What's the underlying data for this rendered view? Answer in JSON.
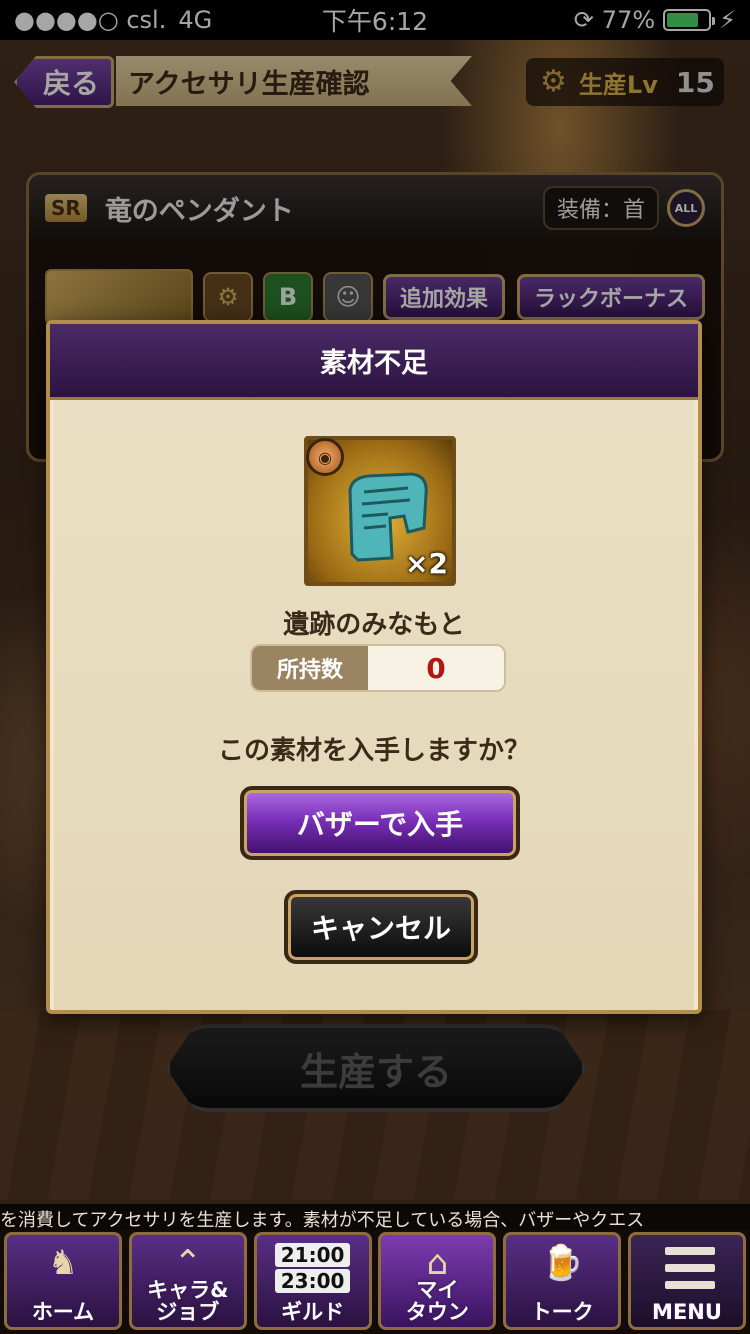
{
  "statusbar": {
    "carrier": "●●●●○ csl.",
    "network": "4G",
    "time": "下午6:12",
    "battery": "77%"
  },
  "header": {
    "back": "戻る",
    "title": "アクセサリ生産確認",
    "level_label": "生産Lv",
    "level_value": "15"
  },
  "item": {
    "rarity": "SR",
    "name": "竜のペンダント",
    "equip": "装備：首",
    "all_label": "ALL",
    "effect_button": "追加効果",
    "luck_button": "ラックボーナス"
  },
  "produce_button": "生産する",
  "modal": {
    "title": "素材不足",
    "material_name": "遺跡のみなもと",
    "quantity": "×2",
    "owned_label": "所持数",
    "owned_value": "0",
    "question": "この素材を入手しますか？",
    "bazaar_button": "バザーで入手",
    "cancel_button": "キャンセル"
  },
  "ticker": "を消費してアクセサリを生産します。素材が不足している場合、バザーやクエス",
  "nav": {
    "home": "ホーム",
    "chara_job_1": "キャラ&",
    "chara_job_2": "ジョブ",
    "guild_time_1": "21:00",
    "guild_time_2": "23:00",
    "guild": "ギルド",
    "mytown_1": "マイ",
    "mytown_2": "タウン",
    "talk": "トーク",
    "menu": "MENU"
  },
  "colors": {
    "accent_purple": "#7a2fb8",
    "gold_border": "#c9a66b",
    "owned_value_red": "#b01818"
  }
}
